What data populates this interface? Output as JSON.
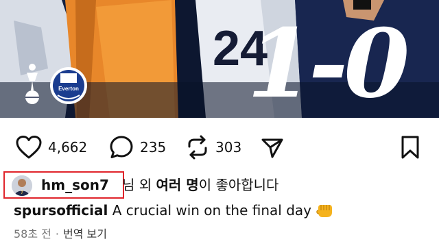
{
  "post": {
    "score_text": "1-0",
    "club_badge_text": "Everton"
  },
  "actions": {
    "likes_count": "4,662",
    "comments_count": "235",
    "reposts_count": "303"
  },
  "liked_by": {
    "user": "hm_son7",
    "suffix": "님",
    "mid": " 외 ",
    "bold": "여러 명",
    "end": "이 좋아합니다"
  },
  "caption": {
    "user": "spursofficial",
    "text": " A crucial win on the final day"
  },
  "meta": {
    "time": "58초 전",
    "separator": "·",
    "translate": "번역 보기"
  },
  "colors": {
    "highlight_border": "#e0242b",
    "everton_blue": "#1b3d8f"
  },
  "icons": [
    "heart-icon",
    "comment-icon",
    "repost-icon",
    "share-icon",
    "bookmark-icon",
    "fist-emoji"
  ]
}
